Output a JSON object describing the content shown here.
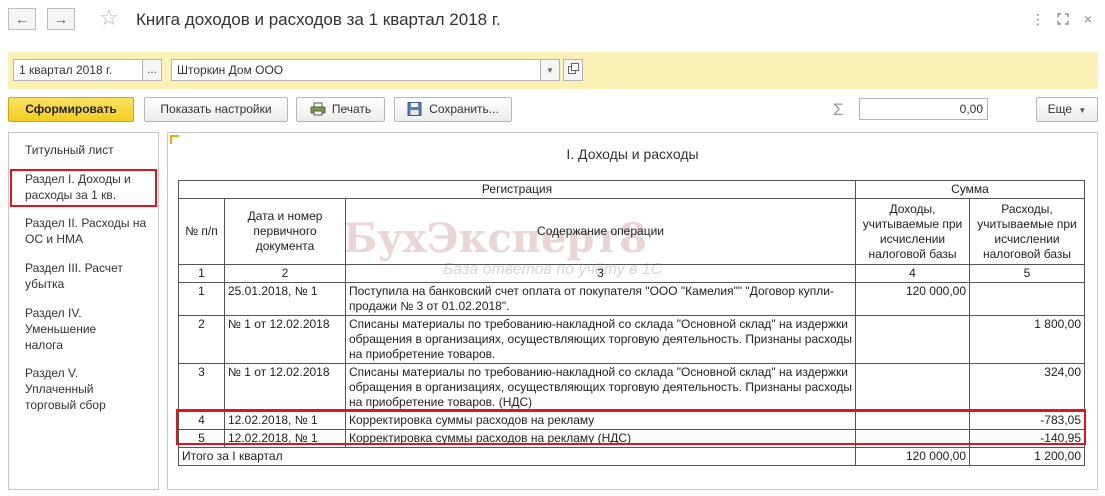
{
  "window": {
    "title": "Книга доходов и расходов за 1 квартал 2018 г.",
    "back_icon": "arrow-left-icon",
    "forward_icon": "arrow-right-icon",
    "favorite_icon": "star-icon",
    "menu_icon": "more-vertical-icon",
    "maximize_icon": "maximize-icon",
    "close_icon": "close-icon"
  },
  "params": {
    "period_value": "1 квартал 2018 г.",
    "period_button": "...",
    "organization_value": "Шторкин Дом ООО",
    "organization_dropdown_icon": "chevron-down-icon",
    "organization_open_icon": "open-icon"
  },
  "toolbar": {
    "generate_label": "Сформировать",
    "settings_label": "Показать настройки",
    "print_label": "Печать",
    "save_label": "Сохранить...",
    "sum_symbol": "Σ",
    "sum_value": "0,00",
    "more_label": "Еще",
    "more_icon": "chevron-down-icon"
  },
  "sidebar": {
    "items": [
      {
        "label": "Титульный лист"
      },
      {
        "label": "Раздел I. Доходы и расходы за 1 кв.",
        "selected": true
      },
      {
        "label": "Раздел II. Расходы на ОС и НМА"
      },
      {
        "label": "Раздел III. Расчет убытка"
      },
      {
        "label": "Раздел IV. Уменьшение налога"
      },
      {
        "label": "Раздел V. Уплаченный торговый сбор"
      }
    ]
  },
  "report": {
    "title": "I. Доходы и расходы",
    "headers": {
      "registration": "Регистрация",
      "sum": "Сумма",
      "num": "№ п/п",
      "date": "Дата и номер первичного документа",
      "content": "Содержание операции",
      "income": "Доходы, учитываемые при исчислении налоговой базы",
      "expenses": "Расходы, учитываемые при исчислении налоговой базы"
    },
    "col_numbers": [
      "1",
      "2",
      "3",
      "4",
      "5"
    ],
    "rows": [
      {
        "num": "1",
        "date": "25.01.2018, № 1",
        "content": "Поступила на банковский счет оплата от покупателя \"ООО \"Камелия\"\" \"Договор купли-продажи № 3 от 01.02.2018\".",
        "income": "120 000,00",
        "expense": ""
      },
      {
        "num": "2",
        "date": "№ 1 от 12.02.2018",
        "content": "Списаны материалы по требованию-накладной со склада \"Основной склад\" на издержки обращения в организациях, осуществляющих торговую деятельность. Признаны расходы на приобретение товаров.",
        "income": "",
        "expense": "1 800,00"
      },
      {
        "num": "3",
        "date": "№ 1 от 12.02.2018",
        "content": "Списаны материалы по требованию-накладной со склада \"Основной склад\" на издержки обращения в организациях, осуществляющих торговую деятельность. Признаны расходы на приобретение товаров. (НДС)",
        "income": "",
        "expense": "324,00"
      },
      {
        "num": "4",
        "date": "12.02.2018, № 1",
        "content": "Корректировка суммы расходов на рекламу",
        "income": "",
        "expense": "-783,05"
      },
      {
        "num": "5",
        "date": "12.02.2018, № 1",
        "content": "Корректировка суммы расходов на рекламу (НДС)",
        "income": "",
        "expense": "-140,95"
      }
    ],
    "total": {
      "label": "Итого за I квартал",
      "income": "120 000,00",
      "expense": "1 200,00"
    },
    "watermark": "БухЭксперт8",
    "watermark_sub": "База ответов по учёту в 1С"
  },
  "colors": {
    "highlight": "#e3131b",
    "params_bg": "#fbf0b5",
    "primary_button": "#f2cd1f"
  }
}
